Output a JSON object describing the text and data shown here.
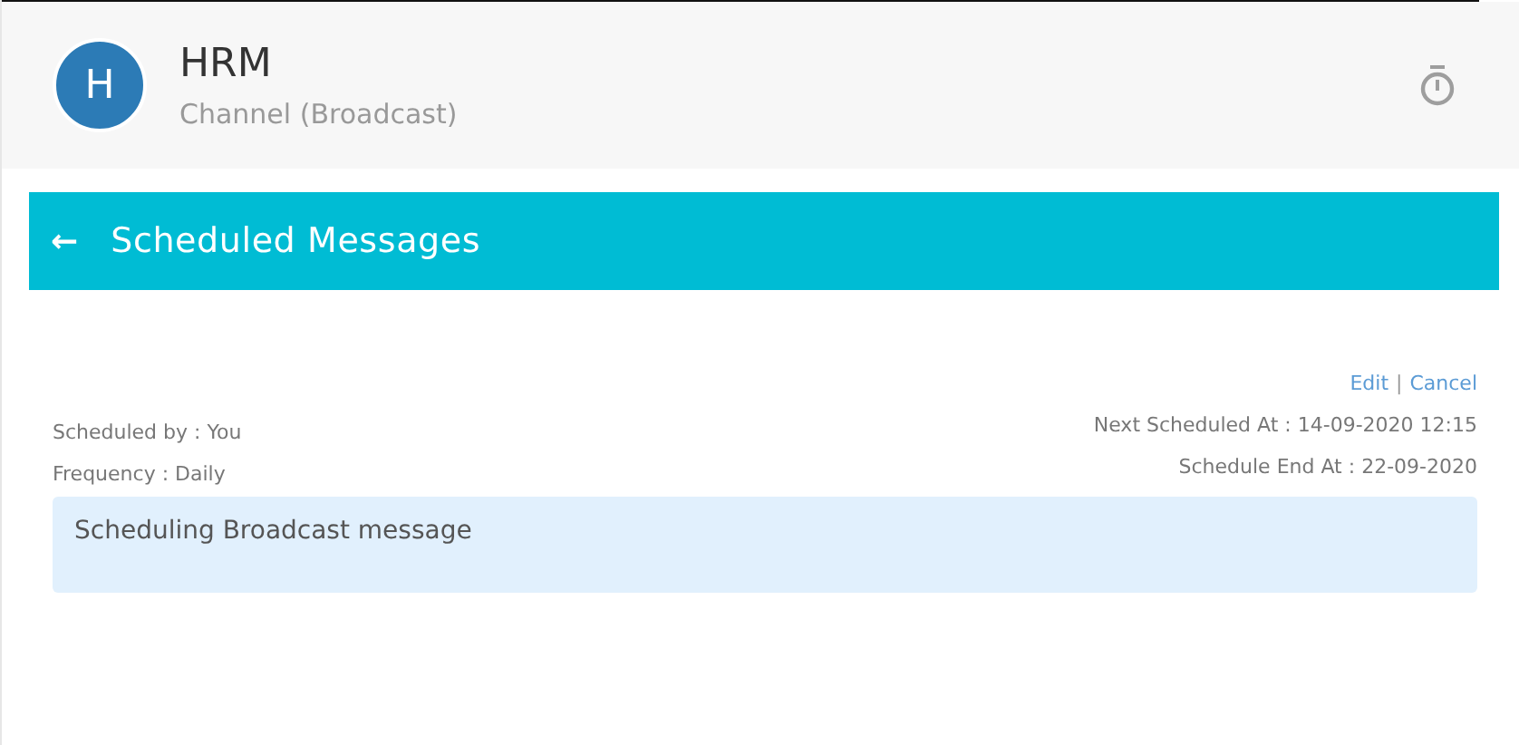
{
  "header": {
    "avatar_letter": "H",
    "title": "HRM",
    "subtitle": "Channel (Broadcast)"
  },
  "toolbar": {
    "back_icon": "←",
    "title": "Scheduled Messages"
  },
  "schedule": {
    "actions": [
      {
        "label": "Edit"
      },
      {
        "label": "Cancel"
      }
    ],
    "separator": "|",
    "left": [
      "Scheduled by : You",
      "Frequency : Daily"
    ],
    "right": [
      "Next Scheduled At : 14-09-2020 12:15",
      "Schedule End At : 22-09-2020"
    ],
    "message": "Scheduling Broadcast message"
  }
}
